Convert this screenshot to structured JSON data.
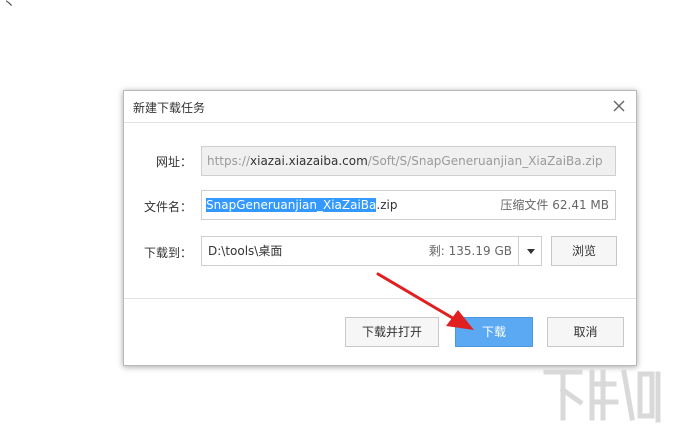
{
  "dialog": {
    "title": "新建下载任务",
    "url": {
      "label": "网址：",
      "prefix": "https://",
      "host": "xiazai.xiazaiba.com",
      "path": "/Soft/S/SnapGeneruanjian_XiaZaiBa.zip"
    },
    "filename": {
      "label": "文件名：",
      "selected_part": "SnapGeneruanjian_XiaZaiBa",
      "extension": ".zip",
      "info": "压缩文件 62.41 MB"
    },
    "save_to": {
      "label": "下载到：",
      "path": "D:\\tools\\桌面",
      "free_space": "剩: 135.19 GB",
      "browse_label": "浏览"
    },
    "buttons": {
      "download_and_open": "下载并打开",
      "download": "下载",
      "cancel": "取消"
    }
  },
  "colors": {
    "primary_button": "#5aa9f2",
    "selection": "#3399ff",
    "annotation_arrow": "#e02020"
  },
  "icons": {
    "close": "close-icon",
    "dropdown": "chevron-down-icon"
  }
}
